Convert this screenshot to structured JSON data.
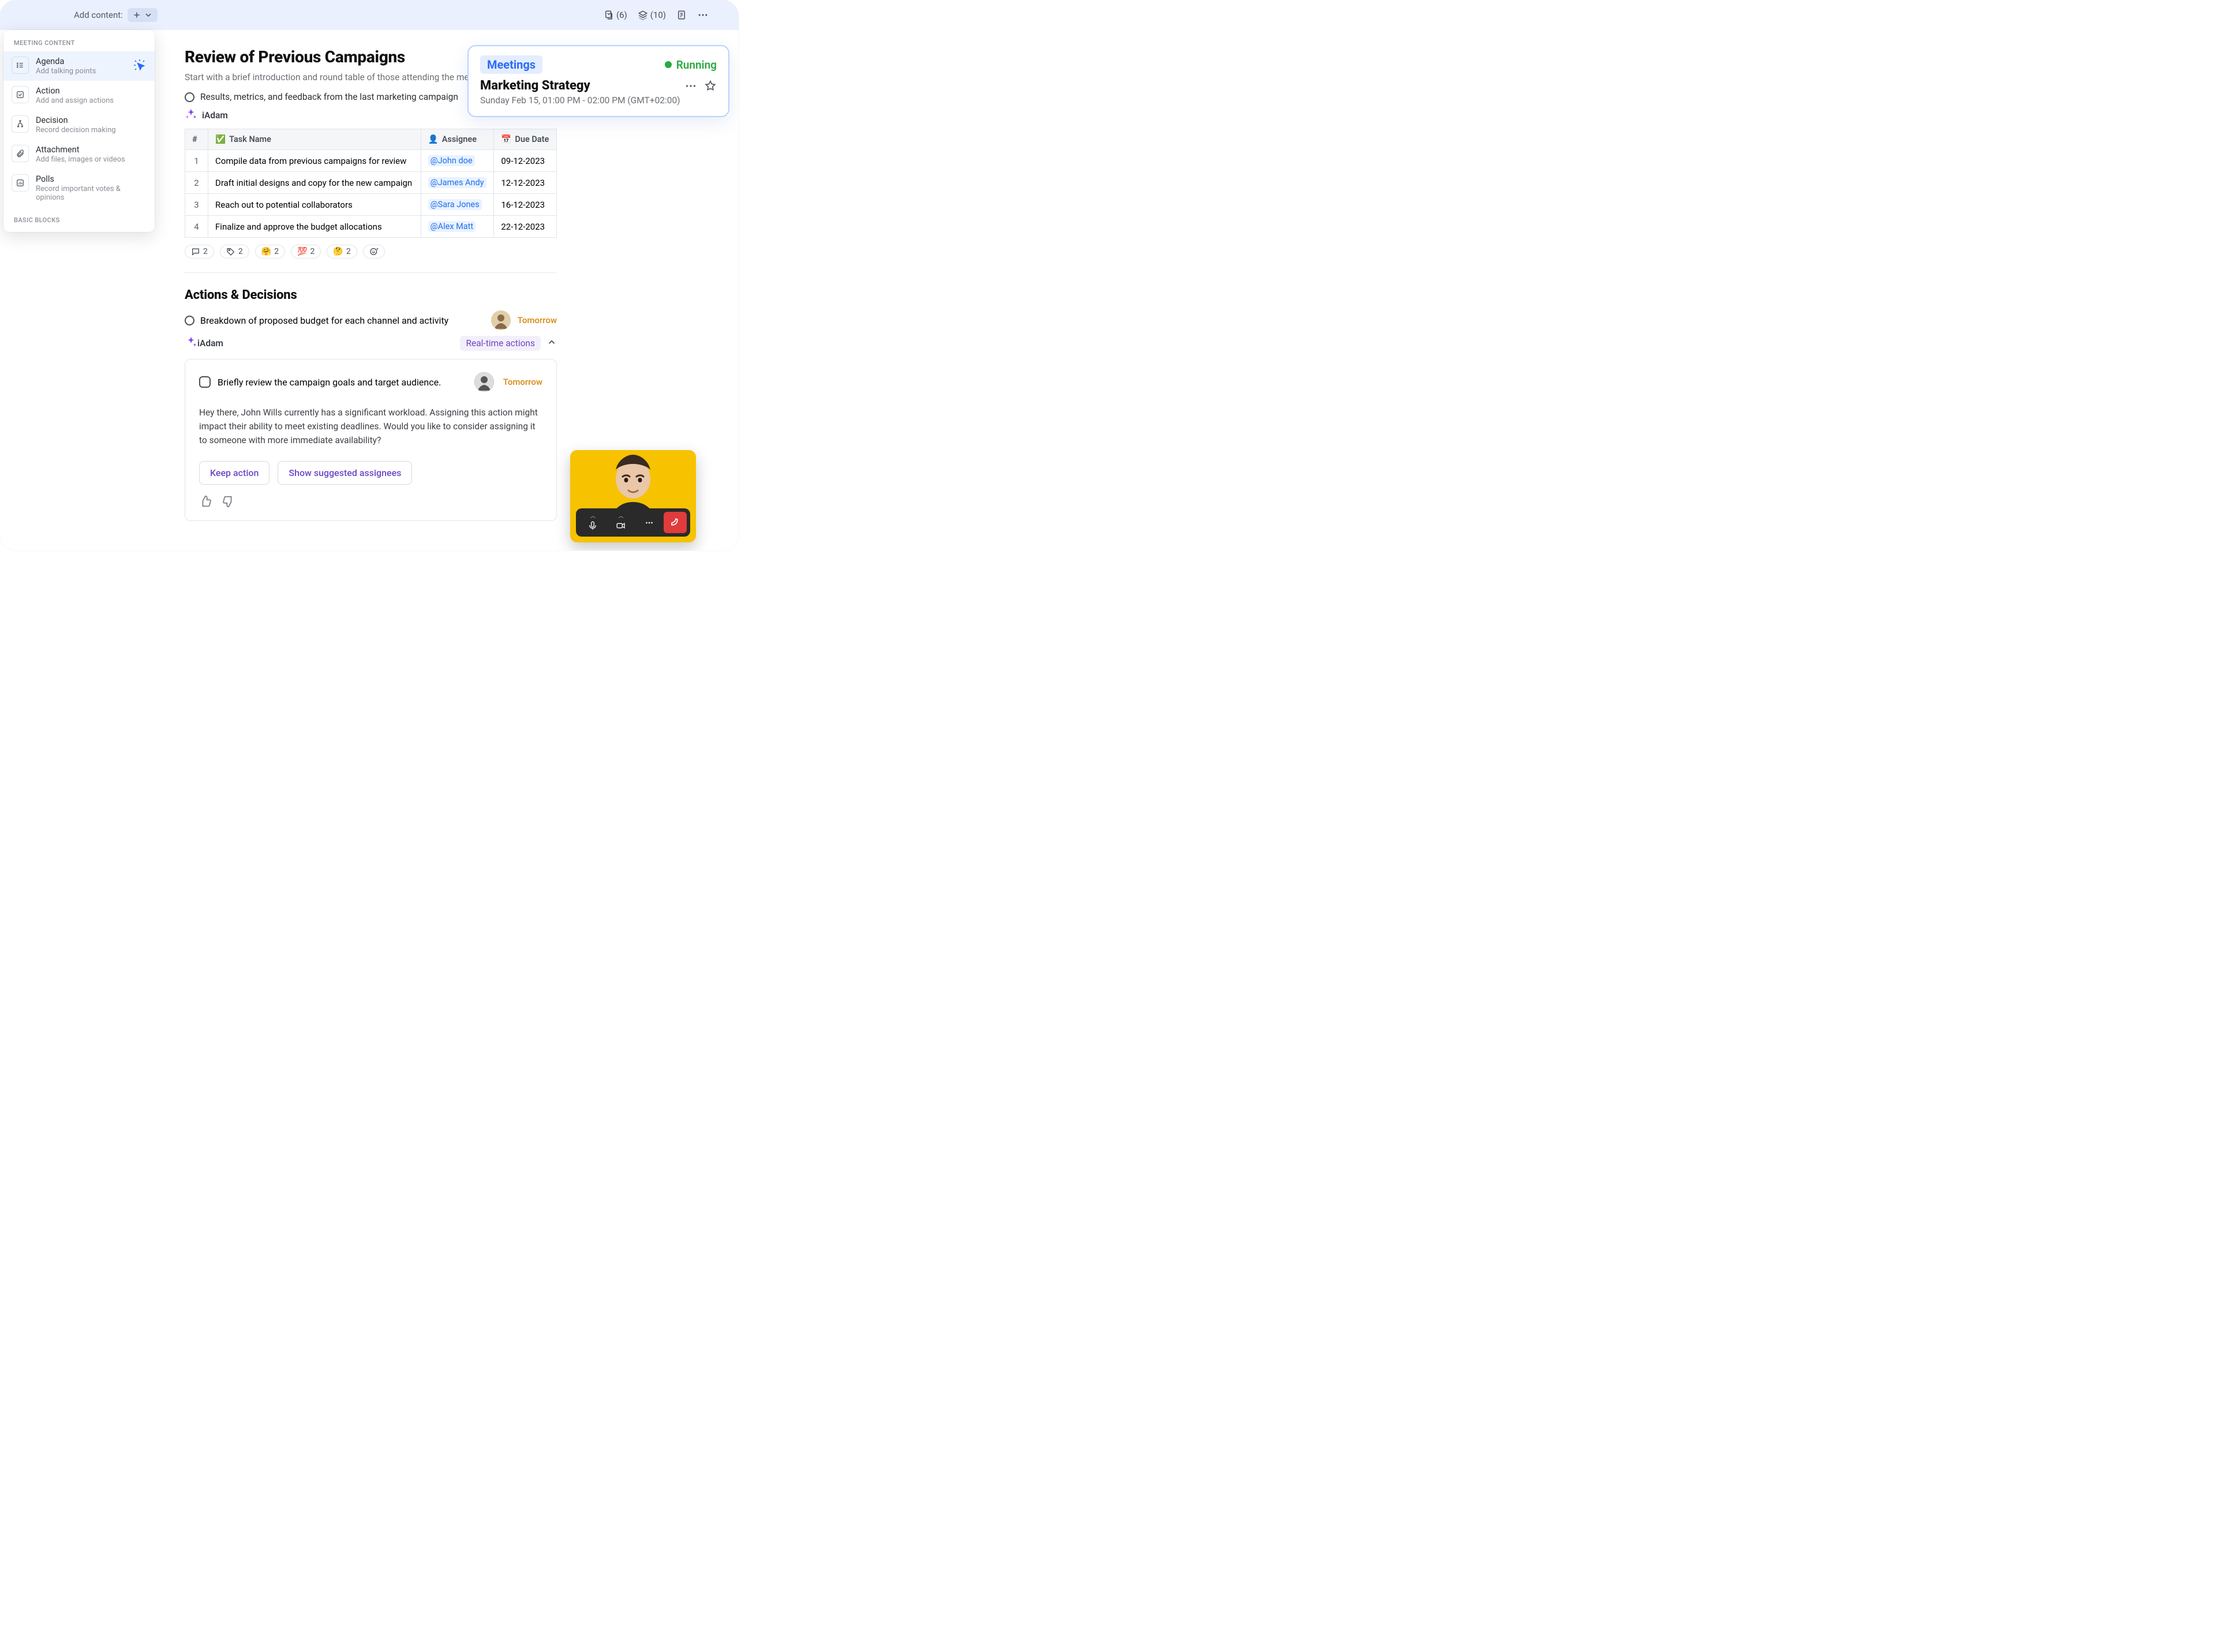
{
  "topbar": {
    "add_label": "Add content:",
    "counts": {
      "docs": "(6)",
      "layers": "(10)"
    }
  },
  "dropdown": {
    "section1": "MEETING CONTENT",
    "section2": "BASIC BLOCKS",
    "items": [
      {
        "title": "Agenda",
        "sub": "Add talking points",
        "icon": "list-icon"
      },
      {
        "title": "Action",
        "sub": "Add and assign actions",
        "icon": "checkbox-icon"
      },
      {
        "title": "Decision",
        "sub": "Record decision making",
        "icon": "fork-icon"
      },
      {
        "title": "Attachment",
        "sub": "Add files, images or videos",
        "icon": "paperclip-icon"
      },
      {
        "title": "Polls",
        "sub": "Record important votes & opinions",
        "icon": "bar-chart-icon"
      }
    ]
  },
  "meeting_card": {
    "badge": "Meetings",
    "status": "Running",
    "title": "Marketing Strategy",
    "date": "Sunday Feb 15, 01:00 PM - 02:00 PM (GMT+02:00)"
  },
  "page": {
    "h1": "Review of Previous Campaigns",
    "subtitle": "Start with a brief introduction and round table of those attending the meeting.",
    "bullet1": "Results, metrics, and feedback from the last marketing campaign",
    "ai_label": "iAdam",
    "h2": "Actions & Decisions",
    "bullet2": "Breakdown of proposed budget for each channel and activity",
    "due_tomorrow": "Tomorrow",
    "realtime": "Real-time actions"
  },
  "table": {
    "headers": {
      "idx": "#",
      "name": "Task Name",
      "assignee": "Assignee",
      "due": "Due Date"
    },
    "rows": [
      {
        "n": "1",
        "name": "Compile data from previous campaigns for review",
        "assignee": "@John doe",
        "due": "09-12-2023"
      },
      {
        "n": "2",
        "name": "Draft initial designs and copy for the new campaign",
        "assignee": "@James Andy",
        "due": "12-12-2023"
      },
      {
        "n": "3",
        "name": "Reach out to potential collaborators",
        "assignee": "@Sara Jones",
        "due": "16-12-2023"
      },
      {
        "n": "4",
        "name": "Finalize and approve the budget allocations",
        "assignee": "@Alex Matt",
        "due": "22-12-2023"
      }
    ]
  },
  "reactions": [
    {
      "emoji": "💬",
      "count": "2"
    },
    {
      "emoji": "🏷️",
      "count": "2"
    },
    {
      "emoji": "🤗",
      "count": "2"
    },
    {
      "emoji": "💯",
      "count": "2"
    },
    {
      "emoji": "🤔",
      "count": "2"
    },
    {
      "emoji": "😊₊",
      "count": ""
    }
  ],
  "callout": {
    "task": "Briefly review the campaign goals and target audience.",
    "due": "Tomorrow",
    "message": "Hey there, John Wills currently has a significant workload. Assigning this action might impact their ability to meet existing deadlines.  Would you like to consider assigning it to someone with more immediate availability?",
    "keep": "Keep action",
    "suggest": "Show suggested assignees"
  }
}
